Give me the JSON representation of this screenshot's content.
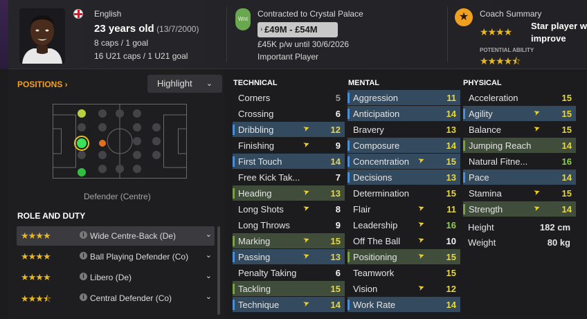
{
  "header": {
    "nationality": "English",
    "age_main": "23 years old",
    "dob": "(13/7/2000)",
    "caps": "8 caps / 1 goal",
    "u21_caps": "16 U21 caps / 1 U21 goal",
    "club_badge_text": "Wnt",
    "contract_club": "Contracted to Crystal Palace",
    "value_range": "£49M - £54M",
    "wage": "£45K p/w until 30/6/2026",
    "status": "Important Player",
    "coach_summary_title": "Coach Summary",
    "coach_summary_text": "Star player w improve",
    "coach_summary_line1": "Star player w",
    "coach_summary_line2": "improve",
    "potential_label": "POTENTIAL ABILITY",
    "current_ability_stars": 4,
    "potential_ability_stars": 4.5
  },
  "left": {
    "positions_title": "POSITIONS",
    "highlight_label": "Highlight",
    "position_name": "Defender (Centre)",
    "role_duty_title": "ROLE AND DUTY",
    "roles": [
      {
        "label": "Wide Centre-Back (De)",
        "stars": 4,
        "selected": true
      },
      {
        "label": "Ball Playing Defender (Co)",
        "stars": 4,
        "selected": false
      },
      {
        "label": "Libero (De)",
        "stars": 4,
        "selected": false
      },
      {
        "label": "Central Defender (Co)",
        "stars": 3.5,
        "selected": false
      }
    ]
  },
  "technical": {
    "title": "TECHNICAL",
    "attrs": [
      {
        "name": "Corners",
        "value": "5",
        "style": "plain",
        "arrow": false,
        "color": "gry"
      },
      {
        "name": "Crossing",
        "value": "6",
        "style": "plain",
        "arrow": false,
        "color": "wht"
      },
      {
        "name": "Dribbling",
        "value": "12",
        "style": "blue",
        "arrow": true,
        "color": "yel"
      },
      {
        "name": "Finishing",
        "value": "9",
        "style": "plain",
        "arrow": true,
        "color": "wht"
      },
      {
        "name": "First Touch",
        "value": "14",
        "style": "blue",
        "arrow": false,
        "color": "yel"
      },
      {
        "name": "Free Kick Tak...",
        "value": "7",
        "style": "plain",
        "arrow": false,
        "color": "wht"
      },
      {
        "name": "Heading",
        "value": "13",
        "style": "green",
        "arrow": true,
        "color": "yel"
      },
      {
        "name": "Long Shots",
        "value": "8",
        "style": "plain",
        "arrow": true,
        "color": "wht"
      },
      {
        "name": "Long Throws",
        "value": "9",
        "style": "plain",
        "arrow": false,
        "color": "wht"
      },
      {
        "name": "Marking",
        "value": "15",
        "style": "green",
        "arrow": true,
        "color": "yel"
      },
      {
        "name": "Passing",
        "value": "13",
        "style": "blue",
        "arrow": true,
        "color": "yel"
      },
      {
        "name": "Penalty Taking",
        "value": "6",
        "style": "plain",
        "arrow": false,
        "color": "wht"
      },
      {
        "name": "Tackling",
        "value": "15",
        "style": "green",
        "arrow": false,
        "color": "yel"
      },
      {
        "name": "Technique",
        "value": "14",
        "style": "blue",
        "arrow": true,
        "color": "yel"
      }
    ]
  },
  "mental": {
    "title": "MENTAL",
    "attrs": [
      {
        "name": "Aggression",
        "value": "11",
        "style": "blue",
        "arrow": false,
        "color": "yel"
      },
      {
        "name": "Anticipation",
        "value": "14",
        "style": "blue",
        "arrow": false,
        "color": "yel"
      },
      {
        "name": "Bravery",
        "value": "13",
        "style": "plain",
        "arrow": false,
        "color": "yel"
      },
      {
        "name": "Composure",
        "value": "14",
        "style": "blue",
        "arrow": false,
        "color": "yel"
      },
      {
        "name": "Concentration",
        "value": "15",
        "style": "blue",
        "arrow": true,
        "color": "yel"
      },
      {
        "name": "Decisions",
        "value": "13",
        "style": "blue",
        "arrow": false,
        "color": "yel"
      },
      {
        "name": "Determination",
        "value": "15",
        "style": "plain",
        "arrow": false,
        "color": "yel"
      },
      {
        "name": "Flair",
        "value": "11",
        "style": "plain",
        "arrow": true,
        "color": "yel"
      },
      {
        "name": "Leadership",
        "value": "16",
        "style": "plain",
        "arrow": true,
        "color": "grn"
      },
      {
        "name": "Off The Ball",
        "value": "10",
        "style": "plain",
        "arrow": true,
        "color": "wht"
      },
      {
        "name": "Positioning",
        "value": "15",
        "style": "green",
        "arrow": true,
        "color": "yel"
      },
      {
        "name": "Teamwork",
        "value": "15",
        "style": "plain",
        "arrow": false,
        "color": "yel"
      },
      {
        "name": "Vision",
        "value": "12",
        "style": "plain",
        "arrow": true,
        "color": "yel"
      },
      {
        "name": "Work Rate",
        "value": "14",
        "style": "blue",
        "arrow": false,
        "color": "yel"
      }
    ]
  },
  "physical": {
    "title": "PHYSICAL",
    "attrs": [
      {
        "name": "Acceleration",
        "value": "15",
        "style": "plain",
        "arrow": false,
        "color": "yel"
      },
      {
        "name": "Agility",
        "value": "15",
        "style": "blue",
        "arrow": true,
        "color": "yel"
      },
      {
        "name": "Balance",
        "value": "15",
        "style": "plain",
        "arrow": true,
        "color": "yel"
      },
      {
        "name": "Jumping Reach",
        "value": "14",
        "style": "green",
        "arrow": false,
        "color": "yel"
      },
      {
        "name": "Natural Fitne...",
        "value": "16",
        "style": "plain",
        "arrow": false,
        "color": "grn"
      },
      {
        "name": "Pace",
        "value": "14",
        "style": "blue",
        "arrow": false,
        "color": "yel"
      },
      {
        "name": "Stamina",
        "value": "15",
        "style": "plain",
        "arrow": true,
        "color": "yel"
      },
      {
        "name": "Strength",
        "value": "14",
        "style": "green",
        "arrow": true,
        "color": "yel"
      }
    ],
    "height_label": "Height",
    "height_value": "182 cm",
    "weight_label": "Weight",
    "weight_value": "80 kg"
  }
}
